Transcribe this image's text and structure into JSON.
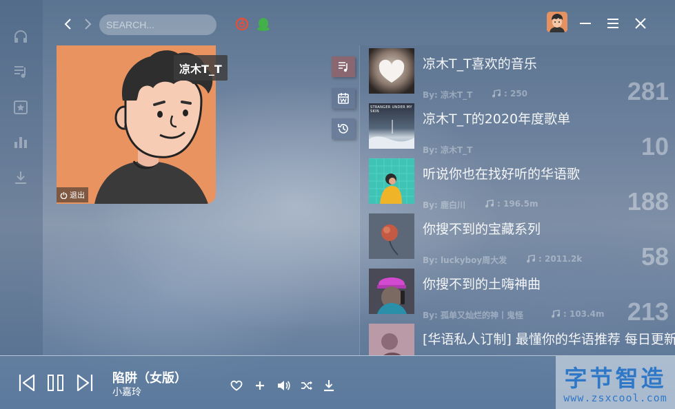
{
  "colors": {
    "accent": "#8a6670",
    "netease_red": "#e0503c",
    "qq_green": "#43b049",
    "watermark_blue": "#2f78c8"
  },
  "rail": {
    "icons": [
      "headphones-icon",
      "playlist-icon",
      "star-icon",
      "chart-icon",
      "download-icon"
    ]
  },
  "header": {
    "search_placeholder": "SEARCH...",
    "source_icons": [
      "netease-music-icon",
      "qq-music-icon"
    ]
  },
  "profile": {
    "username": "凉木T_T",
    "logout_label": "退出"
  },
  "side_tabs": [
    "playlist-tab-icon",
    "calendar-tab-icon",
    "history-tab-icon"
  ],
  "playlists": [
    {
      "title": "凉木T_T喜欢的音乐",
      "creator": "By: 凉木T_T",
      "plays": "250",
      "count": "281"
    },
    {
      "title": "凉木T_T的2020年度歌单",
      "creator": "By: 凉木T_T",
      "plays": "",
      "count": "10"
    },
    {
      "title": "听说你也在找好听的华语歌",
      "creator": "By: 鹿白川",
      "plays": "196.5m",
      "count": "188"
    },
    {
      "title": "你搜不到的宝藏系列",
      "creator": "By: luckyboy周大发",
      "plays": "2011.2k",
      "count": "58"
    },
    {
      "title": "你搜不到的土嗨神曲",
      "creator": "By: 孤单又灿烂的神丨鬼怪",
      "plays": "103.4m",
      "count": "213"
    },
    {
      "title": "[华语私人订制] 最懂你的华语推荐 每日更新",
      "creator": "",
      "plays": "",
      "count": ""
    }
  ],
  "cover_texts": {
    "cover2": "STRANGER UNDER MY SKIN"
  },
  "player": {
    "song_title": "陷阱（女版）",
    "artist": "小嘉玲"
  },
  "watermark": {
    "main": "字节智造",
    "sub": "www.zsxcool.com"
  }
}
